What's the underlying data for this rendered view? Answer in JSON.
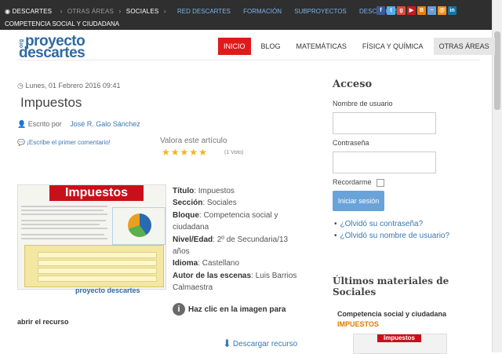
{
  "topbar": {
    "breadcrumbs": [
      "DESCARTES",
      "OTRAS ÁREAS",
      "SOCIALES"
    ],
    "breadcrumb_sub": "COMPETENCIA SOCIAL Y CIUDADANA",
    "links": [
      "RED DESCARTES",
      "FORMACIÓN",
      "SUBPROYECTOS",
      "DESCARGAS"
    ],
    "social_icons": [
      "facebook-icon",
      "twitter-icon",
      "google-plus-icon",
      "youtube-icon",
      "blog-icon",
      "rss-icon",
      "email-icon",
      "linkedin-icon"
    ]
  },
  "logo": {
    "org": "org",
    "line1": "proyecto",
    "line2": "descartes"
  },
  "nav": [
    "INICIO",
    "BLOG",
    "MATEMÁTICAS",
    "FÍSICA Y QUÍMICA",
    "OTRAS ÁREAS"
  ],
  "article": {
    "date": "Lunes, 01 Febrero 2016 09:41",
    "title": "Impuestos",
    "author_label": "Escrito por",
    "author_name": "José R. Galo Sánchez",
    "comment_link": "¡Escribe el primer comentario!",
    "rate_label": "Valora este artículo",
    "rating": 5,
    "votes": "(1 Voto)",
    "thumbnail_title": "Impuestos",
    "thumbnail_footer": "proyecto descartes",
    "info": [
      {
        "label": "Título",
        "value": "Impuestos"
      },
      {
        "label": "Sección",
        "value": "Sociales"
      },
      {
        "label": "Bloque",
        "value": "Competencia social y ciudadana"
      },
      {
        "label": "Nivel/Edad",
        "value": "2º de Secundaria/13 años"
      },
      {
        "label": "Idioma",
        "value": "Castellano"
      },
      {
        "label": "Autor de las escenas",
        "value": "Luis Barrios Calmaestra"
      }
    ],
    "click_text": "Haz clic en la imagen para",
    "open_text": "abrir el recurso",
    "download_text": "Descargar recurso"
  },
  "sidebar": {
    "login_title": "Acceso",
    "user_label": "Nombre de usuario",
    "pass_label": "Contraseña",
    "remember_label": "Recordarme",
    "login_button": "Iniciar sesión",
    "forgot_pass": "¿Olvidó su contraseña?",
    "forgot_user": "¿Olvidó su nombre de usuario?",
    "latest_title": "Últimos materiales de Sociales",
    "latest_category": "Competencia social y ciudadana",
    "latest_item": "IMPUESTOS",
    "latest_thumb_title": "Impuestos"
  }
}
